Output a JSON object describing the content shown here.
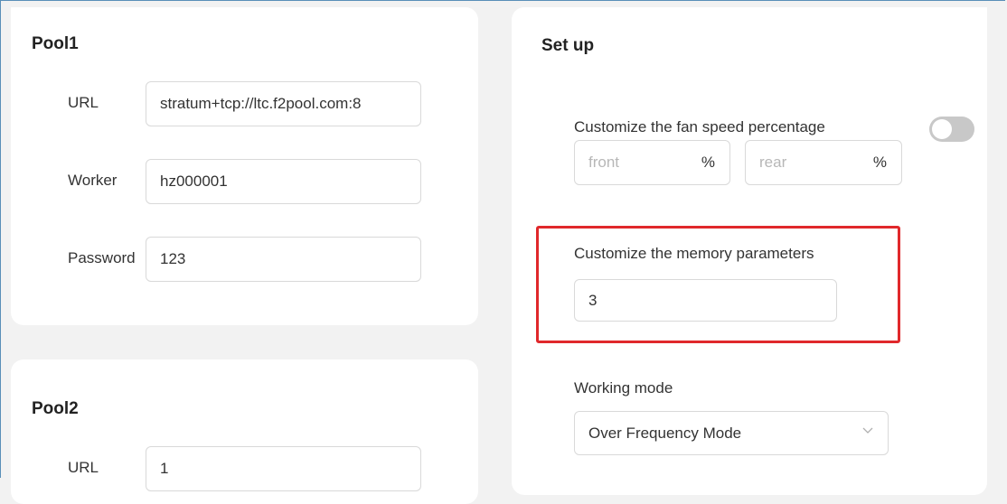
{
  "pool1": {
    "title": "Pool1",
    "url_label": "URL",
    "url_value": "stratum+tcp://ltc.f2pool.com:8",
    "worker_label": "Worker",
    "worker_value": "hz000001",
    "password_label": "Password",
    "password_value": "123"
  },
  "pool2": {
    "title": "Pool2",
    "url_label": "URL",
    "url_value": "1"
  },
  "setup": {
    "title": "Set up",
    "fan_label": "Customize the fan speed percentage",
    "fan_toggle_on": false,
    "front_placeholder": "front",
    "front_unit": "%",
    "rear_placeholder": "rear",
    "rear_unit": "%",
    "memory_label": "Customize the memory parameters",
    "memory_value": "3",
    "mode_label": "Working mode",
    "mode_value": "Over Frequency Mode"
  },
  "colors": {
    "highlight": "#e0282b",
    "toggle_off": "#c8c8c8",
    "background": "#f2f2f2"
  }
}
